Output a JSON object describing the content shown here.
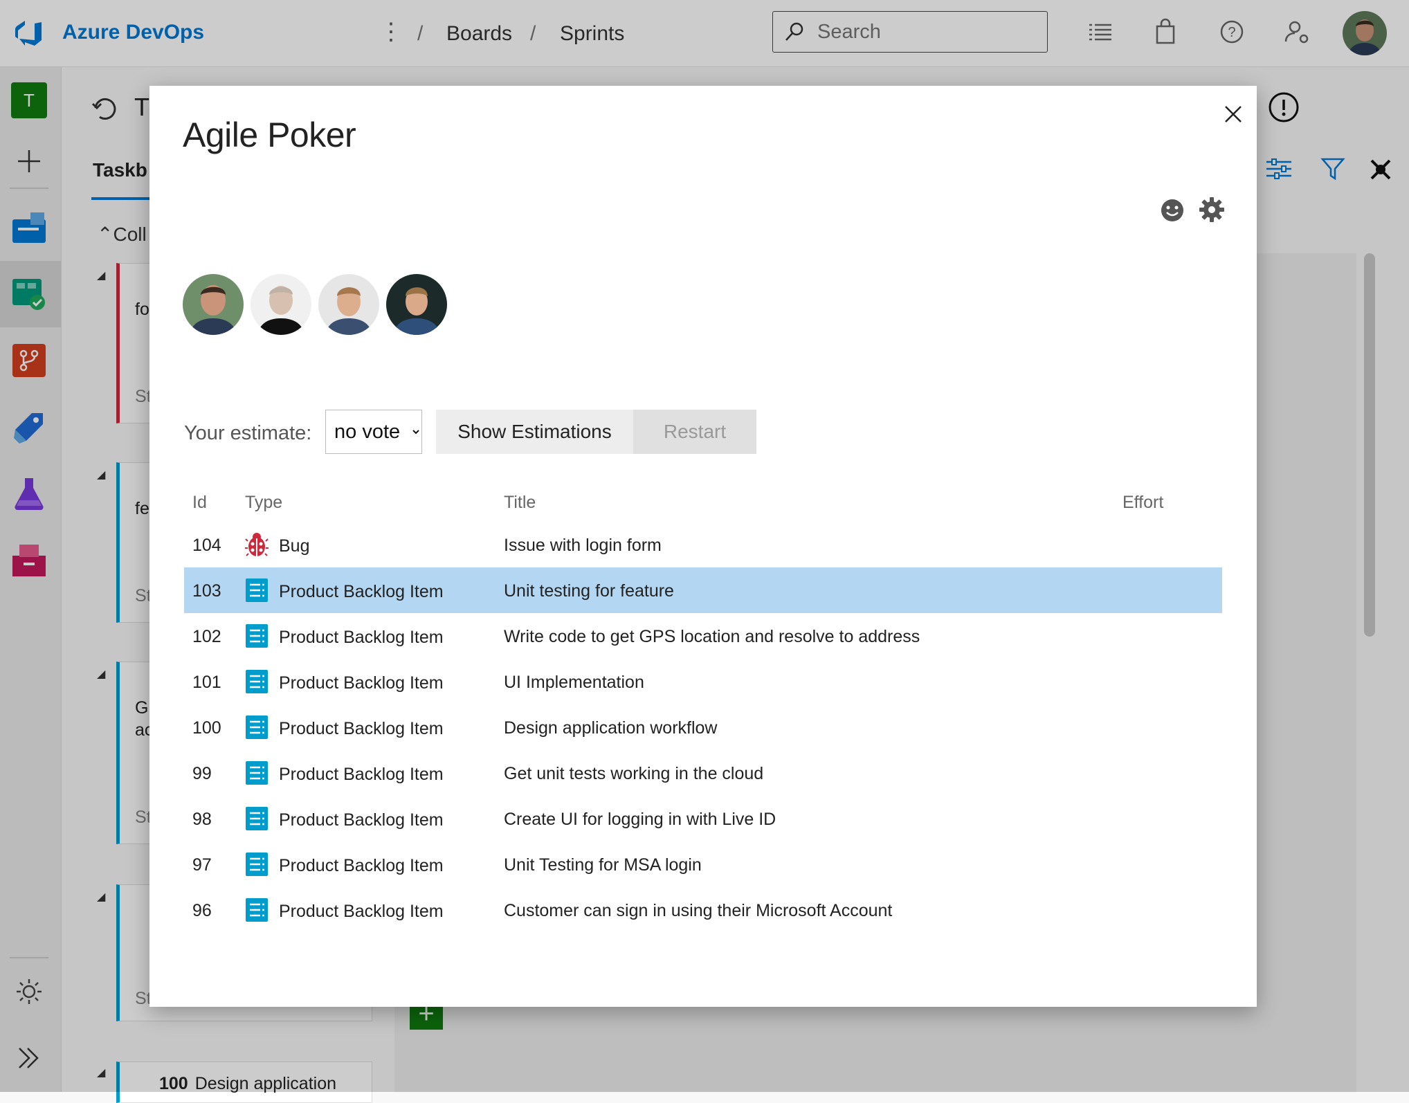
{
  "header": {
    "brand": "Azure DevOps",
    "breadcrumb": [
      "Boards",
      "Sprints"
    ],
    "separator": "/",
    "search_placeholder": "Search"
  },
  "rail": {
    "project_initial": "T"
  },
  "background_board": {
    "page_title": "T",
    "tab": "Taskb",
    "collapse_label": "Coll",
    "cards": [
      {
        "line1": "fo",
        "state": "St"
      },
      {
        "line1": "fe",
        "state": "St"
      },
      {
        "line1": "GI",
        "line2": "ac",
        "state": "St"
      },
      {
        "line1": "",
        "state": "St"
      }
    ],
    "bottom_card": {
      "id": "100",
      "title": "Design application"
    }
  },
  "dialog": {
    "title": "Agile Poker",
    "estimate_label": "Your estimate:",
    "estimate_value": "no vote",
    "show_button": "Show Estimations",
    "restart_button": "Restart",
    "columns": {
      "id": "Id",
      "type": "Type",
      "title": "Title",
      "effort": "Effort"
    },
    "selected_id": "103",
    "rows": [
      {
        "id": "104",
        "type": "Bug",
        "icon": "bug-icon",
        "title": "Issue with login form",
        "effort": ""
      },
      {
        "id": "103",
        "type": "Product Backlog Item",
        "icon": "backlog-item-icon",
        "title": "Unit testing for feature",
        "effort": ""
      },
      {
        "id": "102",
        "type": "Product Backlog Item",
        "icon": "backlog-item-icon",
        "title": "Write code to get GPS location and resolve to address",
        "effort": ""
      },
      {
        "id": "101",
        "type": "Product Backlog Item",
        "icon": "backlog-item-icon",
        "title": "UI Implementation",
        "effort": ""
      },
      {
        "id": "100",
        "type": "Product Backlog Item",
        "icon": "backlog-item-icon",
        "title": "Design application workflow",
        "effort": ""
      },
      {
        "id": "99",
        "type": "Product Backlog Item",
        "icon": "backlog-item-icon",
        "title": "Get unit tests working in the cloud",
        "effort": ""
      },
      {
        "id": "98",
        "type": "Product Backlog Item",
        "icon": "backlog-item-icon",
        "title": "Create UI for logging in with Live ID",
        "effort": ""
      },
      {
        "id": "97",
        "type": "Product Backlog Item",
        "icon": "backlog-item-icon",
        "title": "Unit Testing for MSA login",
        "effort": ""
      },
      {
        "id": "96",
        "type": "Product Backlog Item",
        "icon": "backlog-item-icon",
        "title": "Customer can sign in using their Microsoft Account",
        "effort": ""
      }
    ]
  },
  "colors": {
    "accent": "#0078d4",
    "selected_row": "#b3d6f2",
    "bug_red": "#cc293d",
    "backlog_blue": "#009ccc",
    "project_green": "#107c10"
  }
}
